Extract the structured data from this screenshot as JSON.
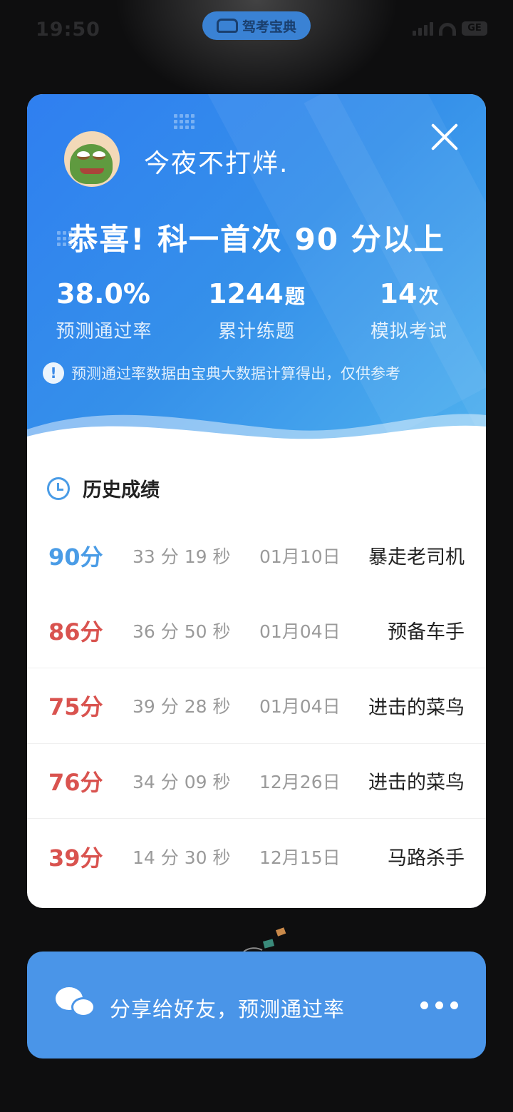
{
  "status_bar": {
    "time": "19:50",
    "app_pill": "驾考宝典",
    "battery": "GE"
  },
  "hero": {
    "username": "今夜不打烊.",
    "congrats": "恭喜! 科一首次 90 分以上",
    "stats": [
      {
        "value": "38.0%",
        "unit": "",
        "label": "预测通过率"
      },
      {
        "value": "1244",
        "unit": "题",
        "label": "累计练题"
      },
      {
        "value": "14",
        "unit": "次",
        "label": "模拟考试"
      }
    ],
    "notice": "预测通过率数据由宝典大数据计算得出，仅供参考"
  },
  "history": {
    "title": "历史成绩",
    "rows": [
      {
        "score": "90分",
        "duration": "33 分 19 秒",
        "date": "01月10日",
        "title": "暴走老司机"
      },
      {
        "score": "86分",
        "duration": "36 分 50 秒",
        "date": "01月04日",
        "title": "预备车手"
      },
      {
        "score": "75分",
        "duration": "39 分 28 秒",
        "date": "01月04日",
        "title": "进击的菜鸟"
      },
      {
        "score": "76分",
        "duration": "34 分 09 秒",
        "date": "12月26日",
        "title": "进击的菜鸟"
      },
      {
        "score": "39分",
        "duration": "14 分 30 秒",
        "date": "12月15日",
        "title": "马路杀手"
      }
    ]
  },
  "share": {
    "label": "分享给好友，预测通过率"
  },
  "colors": {
    "accent": "#4a9ce6",
    "fail": "#d9534f",
    "hero_start": "#2f7ff0",
    "hero_end": "#4fb1ee",
    "share_bg": "#4a95e8"
  }
}
